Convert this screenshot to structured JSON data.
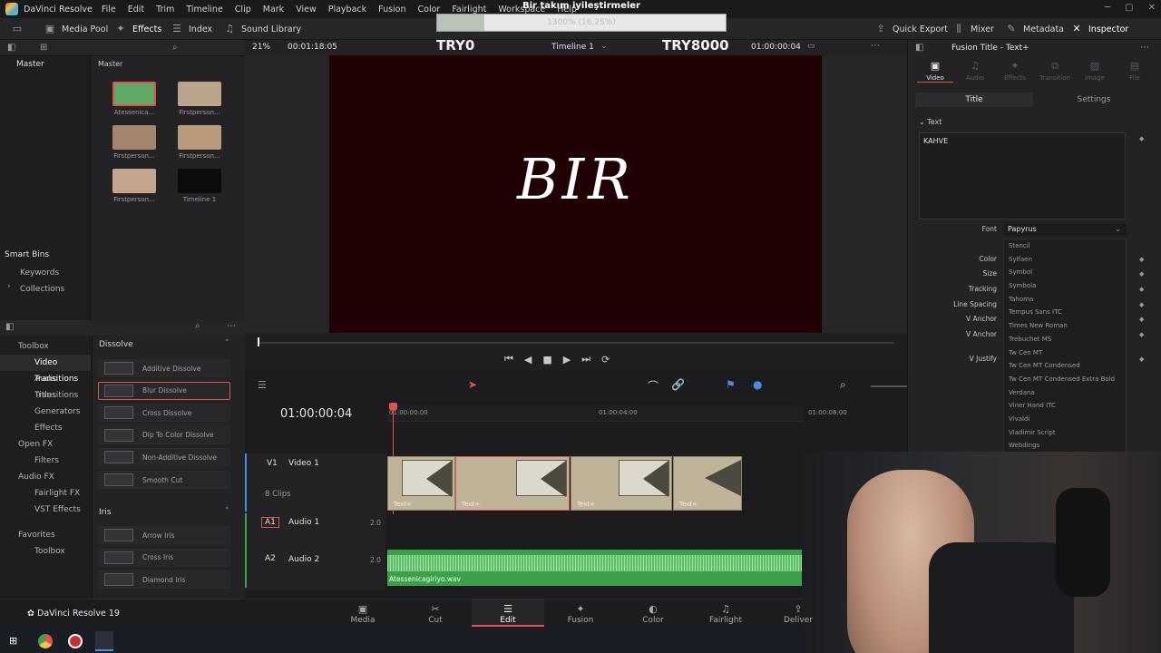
{
  "app": {
    "title": "DaVinci Resolve",
    "brand_label": "DaVinci Resolve 19"
  },
  "menu": [
    "File",
    "Edit",
    "Trim",
    "Timeline",
    "Clip",
    "Mark",
    "View",
    "Playback",
    "Fusion",
    "Color",
    "Fairlight",
    "Workspace",
    "Help"
  ],
  "overlay": {
    "title": "Bir takım iyileştirmeler",
    "progress_text": "1300% (16.25%)",
    "progress_value": 0.1625,
    "left_label": "TRY0",
    "right_label": "TRY8000"
  },
  "toolbar": {
    "media_pool": "Media Pool",
    "effects": "Effects",
    "index": "Index",
    "sound_library": "Sound Library",
    "quick_export": "Quick Export",
    "mixer": "Mixer",
    "metadata": "Metadata",
    "inspector": "Inspector"
  },
  "viewer": {
    "zoom": "21%",
    "duration": "00:01:18:05",
    "timeline_name": "Timeline 1",
    "timecode": "01:00:00:04",
    "preview_text": "BIR",
    "inspector_title": "Fusion Title - Text+"
  },
  "mediapool": {
    "bin_header": "Master",
    "bins": [
      "Master"
    ],
    "smart_bins": "Smart Bins",
    "smart_items": [
      "Keywords",
      "Collections"
    ],
    "clips": [
      {
        "name": "Atessenica...",
        "color": "#5fa866"
      },
      {
        "name": "Firstperson...",
        "color": "#b9a48c"
      },
      {
        "name": "Firstperson...",
        "color": "#a4866e"
      },
      {
        "name": "Firstperson...",
        "color": "#b99b7c"
      },
      {
        "name": "Firstperson...",
        "color": "#c4a68e"
      },
      {
        "name": "Timeline 1",
        "color": "#0c0c0c"
      }
    ]
  },
  "effects_nav": [
    "Toolbox",
    "Video Transitions",
    "Audio Transitions",
    "Titles",
    "Generators",
    "Effects",
    "Open FX",
    "Filters",
    "Audio FX",
    "Fairlight FX",
    "VST Effects",
    "Favorites",
    "Toolbox"
  ],
  "effects_sections": {
    "dissolve": "Dissolve",
    "iris": "Iris"
  },
  "dissolve_items": [
    "Additive Dissolve",
    "Blur Dissolve",
    "Cross Dissolve",
    "Dip To Color Dissolve",
    "Non-Additive Dissolve",
    "Smooth Cut"
  ],
  "iris_items": [
    "Arrow Iris",
    "Cross Iris",
    "Diamond Iris"
  ],
  "timeline": {
    "timecode": "01:00:00:04",
    "ruler": [
      "01:00:00:00",
      "01:00:04:00",
      "01:00:08:00"
    ],
    "video_track": {
      "id": "V1",
      "name": "Video 1",
      "count": "8 Clips"
    },
    "audio_tracks": [
      {
        "id": "A1",
        "name": "Audio 1",
        "ch": "2.0"
      },
      {
        "id": "A2",
        "name": "Audio 2",
        "ch": "2.0"
      }
    ],
    "clip_label": "Text+",
    "audio_clip": "Atessenicagiriyo.wav"
  },
  "inspector": {
    "tabs": [
      "Video",
      "Audio",
      "Effects",
      "Transition",
      "Image",
      "File"
    ],
    "subtabs": [
      "Title",
      "Settings"
    ],
    "section": "Text",
    "text_value": "KAHVE",
    "labels": [
      "Font",
      "Color",
      "Size",
      "Tracking",
      "Line Spacing",
      "V Anchor",
      "V Anchor",
      "V Justify"
    ],
    "font_value": "Papyrus",
    "font_options": [
      "Stencil",
      "Sylfaen",
      "Symbol",
      "Symbola",
      "Tahoma",
      "Tempus Sans ITC",
      "Times New Roman",
      "Trebuchet MS",
      "Tw Cen MT",
      "Tw Cen MT Condensed",
      "Tw Cen MT Condensed Extra Bold",
      "Verdana",
      "Viner Hand ITC",
      "Vivaldi",
      "Vladimir Script",
      "Webdings"
    ]
  },
  "pages": [
    "Media",
    "Cut",
    "Edit",
    "Fusion",
    "Color",
    "Fairlight",
    "Deliver"
  ],
  "active_page": "Edit"
}
